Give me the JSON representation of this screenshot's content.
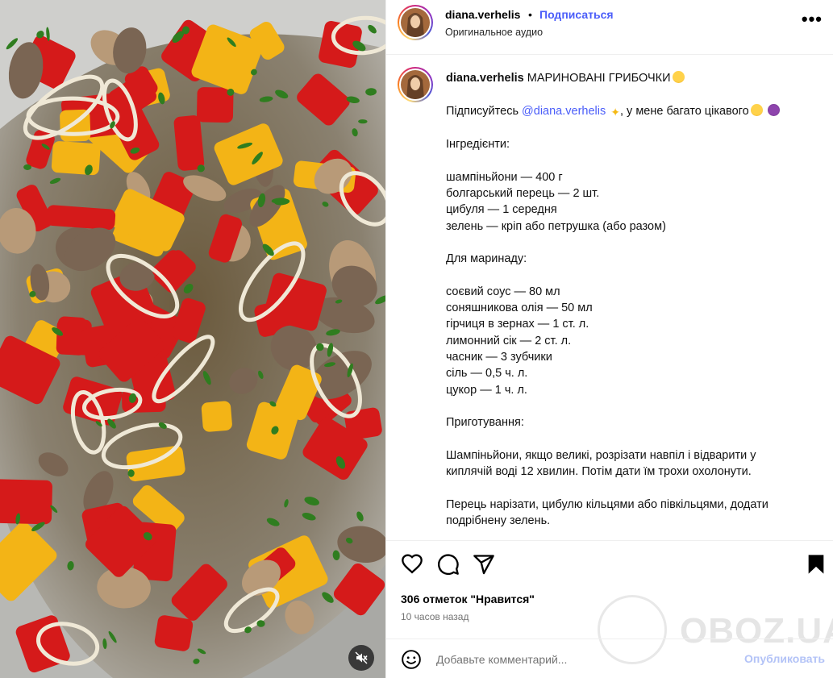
{
  "media": {
    "alt_icon": "muted-speaker-icon",
    "colors": {
      "red_pepper": "#d51a1a",
      "yellow_pepper": "#f3b416",
      "mushroom": "#7a6553",
      "bowl": "#9d9d9a"
    }
  },
  "header": {
    "username": "diana.verhelis",
    "dot": "•",
    "follow_label": "Подписаться",
    "audio_label": "Оригинальное аудио",
    "more_label": "•••"
  },
  "caption": {
    "username": "diana.verhelis",
    "title": "МАРИНОВАНІ ГРИБОЧКИ",
    "intro_before": "Підписуйтесь ",
    "mention": "@diana.verhelis",
    "intro_after": ", у мене багато цікавого",
    "lines": [
      "Інгредієнти:",
      "",
      "шампіньйони — 400 г",
      "болгарський перець — 2 шт.",
      "цибуля — 1 середня",
      "зелень — кріп або петрушка (або разом)",
      "",
      "Для маринаду:",
      "",
      "соєвий соус — 80 мл",
      "соняшникова олія — 50 мл",
      "гірчиця в зернах — 1 ст. л.",
      "лимонний сік — 2 ст. л.",
      "часник — 3 зубчики",
      "сіль — 0,5 ч. л.",
      "цукор — 1 ч. л.",
      "",
      "Приготування:",
      "",
      "Шампіньйони, якщо великі, розрізати навпіл і відварити у",
      "киплячій воді 12 хвилин. Потім дати їм трохи охолонути.",
      "",
      "Перець нарізати, цибулю кільцями або півкільцями, додати",
      "подрібнену зелень."
    ]
  },
  "actions": {
    "likes_text": "306 отметок \"Нравится\"",
    "time_text": "10 часов назад"
  },
  "watermark": {
    "text": "OBOZ.UA"
  },
  "comment_box": {
    "placeholder": "Добавьте комментарий...",
    "post_label": "Опубликовать"
  }
}
